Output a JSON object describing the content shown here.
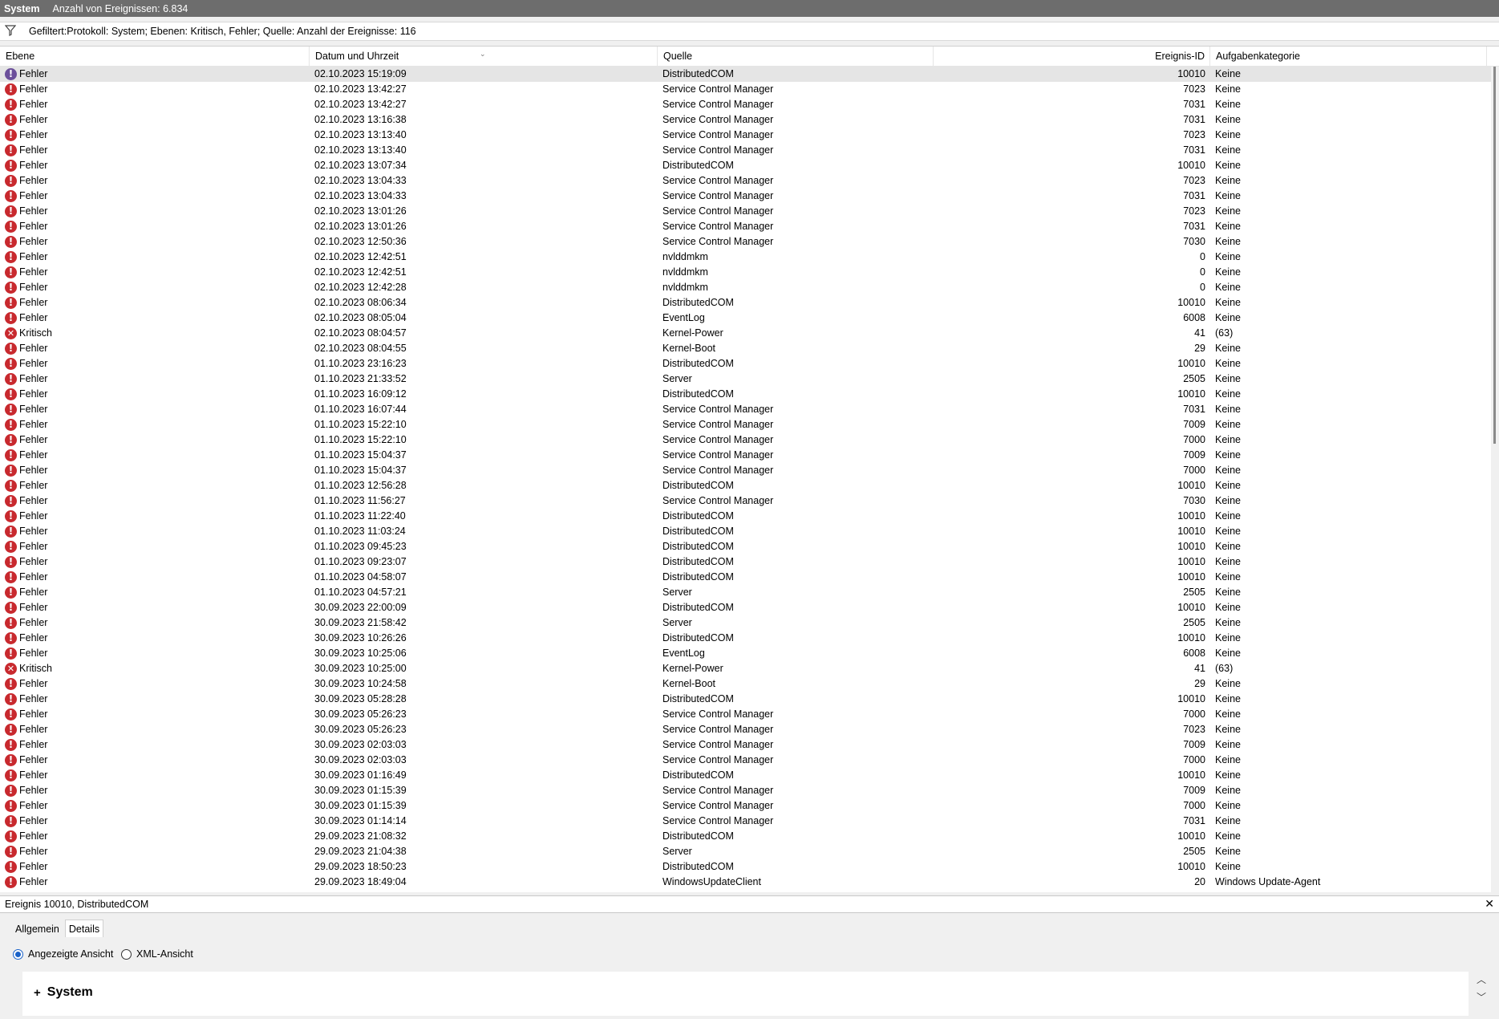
{
  "titlebar": {
    "log_name": "System",
    "count_text": "Anzahl von Ereignissen: 6.834"
  },
  "filter": {
    "text": "Gefiltert:Protokoll: System; Ebenen: Kritisch, Fehler; Quelle:  Anzahl der Ereignisse: 116"
  },
  "columns": {
    "level": "Ebene",
    "date": "Datum und Uhrzeit",
    "source": "Quelle",
    "id": "Ereignis-ID",
    "category": "Aufgabenkategorie"
  },
  "rows": [
    {
      "level": "Fehler",
      "date": "02.10.2023 15:19:09",
      "source": "DistributedCOM",
      "id": "10010",
      "category": "Keine"
    },
    {
      "level": "Fehler",
      "date": "02.10.2023 13:42:27",
      "source": "Service Control Manager",
      "id": "7023",
      "category": "Keine"
    },
    {
      "level": "Fehler",
      "date": "02.10.2023 13:42:27",
      "source": "Service Control Manager",
      "id": "7031",
      "category": "Keine"
    },
    {
      "level": "Fehler",
      "date": "02.10.2023 13:16:38",
      "source": "Service Control Manager",
      "id": "7031",
      "category": "Keine"
    },
    {
      "level": "Fehler",
      "date": "02.10.2023 13:13:40",
      "source": "Service Control Manager",
      "id": "7023",
      "category": "Keine"
    },
    {
      "level": "Fehler",
      "date": "02.10.2023 13:13:40",
      "source": "Service Control Manager",
      "id": "7031",
      "category": "Keine"
    },
    {
      "level": "Fehler",
      "date": "02.10.2023 13:07:34",
      "source": "DistributedCOM",
      "id": "10010",
      "category": "Keine"
    },
    {
      "level": "Fehler",
      "date": "02.10.2023 13:04:33",
      "source": "Service Control Manager",
      "id": "7023",
      "category": "Keine"
    },
    {
      "level": "Fehler",
      "date": "02.10.2023 13:04:33",
      "source": "Service Control Manager",
      "id": "7031",
      "category": "Keine"
    },
    {
      "level": "Fehler",
      "date": "02.10.2023 13:01:26",
      "source": "Service Control Manager",
      "id": "7023",
      "category": "Keine"
    },
    {
      "level": "Fehler",
      "date": "02.10.2023 13:01:26",
      "source": "Service Control Manager",
      "id": "7031",
      "category": "Keine"
    },
    {
      "level": "Fehler",
      "date": "02.10.2023 12:50:36",
      "source": "Service Control Manager",
      "id": "7030",
      "category": "Keine"
    },
    {
      "level": "Fehler",
      "date": "02.10.2023 12:42:51",
      "source": "nvlddmkm",
      "id": "0",
      "category": "Keine"
    },
    {
      "level": "Fehler",
      "date": "02.10.2023 12:42:51",
      "source": "nvlddmkm",
      "id": "0",
      "category": "Keine"
    },
    {
      "level": "Fehler",
      "date": "02.10.2023 12:42:28",
      "source": "nvlddmkm",
      "id": "0",
      "category": "Keine"
    },
    {
      "level": "Fehler",
      "date": "02.10.2023 08:06:34",
      "source": "DistributedCOM",
      "id": "10010",
      "category": "Keine"
    },
    {
      "level": "Fehler",
      "date": "02.10.2023 08:05:04",
      "source": "EventLog",
      "id": "6008",
      "category": "Keine"
    },
    {
      "level": "Kritisch",
      "date": "02.10.2023 08:04:57",
      "source": "Kernel-Power",
      "id": "41",
      "category": "(63)"
    },
    {
      "level": "Fehler",
      "date": "02.10.2023 08:04:55",
      "source": "Kernel-Boot",
      "id": "29",
      "category": "Keine"
    },
    {
      "level": "Fehler",
      "date": "01.10.2023 23:16:23",
      "source": "DistributedCOM",
      "id": "10010",
      "category": "Keine"
    },
    {
      "level": "Fehler",
      "date": "01.10.2023 21:33:52",
      "source": "Server",
      "id": "2505",
      "category": "Keine"
    },
    {
      "level": "Fehler",
      "date": "01.10.2023 16:09:12",
      "source": "DistributedCOM",
      "id": "10010",
      "category": "Keine"
    },
    {
      "level": "Fehler",
      "date": "01.10.2023 16:07:44",
      "source": "Service Control Manager",
      "id": "7031",
      "category": "Keine"
    },
    {
      "level": "Fehler",
      "date": "01.10.2023 15:22:10",
      "source": "Service Control Manager",
      "id": "7009",
      "category": "Keine"
    },
    {
      "level": "Fehler",
      "date": "01.10.2023 15:22:10",
      "source": "Service Control Manager",
      "id": "7000",
      "category": "Keine"
    },
    {
      "level": "Fehler",
      "date": "01.10.2023 15:04:37",
      "source": "Service Control Manager",
      "id": "7009",
      "category": "Keine"
    },
    {
      "level": "Fehler",
      "date": "01.10.2023 15:04:37",
      "source": "Service Control Manager",
      "id": "7000",
      "category": "Keine"
    },
    {
      "level": "Fehler",
      "date": "01.10.2023 12:56:28",
      "source": "DistributedCOM",
      "id": "10010",
      "category": "Keine"
    },
    {
      "level": "Fehler",
      "date": "01.10.2023 11:56:27",
      "source": "Service Control Manager",
      "id": "7030",
      "category": "Keine"
    },
    {
      "level": "Fehler",
      "date": "01.10.2023 11:22:40",
      "source": "DistributedCOM",
      "id": "10010",
      "category": "Keine"
    },
    {
      "level": "Fehler",
      "date": "01.10.2023 11:03:24",
      "source": "DistributedCOM",
      "id": "10010",
      "category": "Keine"
    },
    {
      "level": "Fehler",
      "date": "01.10.2023 09:45:23",
      "source": "DistributedCOM",
      "id": "10010",
      "category": "Keine"
    },
    {
      "level": "Fehler",
      "date": "01.10.2023 09:23:07",
      "source": "DistributedCOM",
      "id": "10010",
      "category": "Keine"
    },
    {
      "level": "Fehler",
      "date": "01.10.2023 04:58:07",
      "source": "DistributedCOM",
      "id": "10010",
      "category": "Keine"
    },
    {
      "level": "Fehler",
      "date": "01.10.2023 04:57:21",
      "source": "Server",
      "id": "2505",
      "category": "Keine"
    },
    {
      "level": "Fehler",
      "date": "30.09.2023 22:00:09",
      "source": "DistributedCOM",
      "id": "10010",
      "category": "Keine"
    },
    {
      "level": "Fehler",
      "date": "30.09.2023 21:58:42",
      "source": "Server",
      "id": "2505",
      "category": "Keine"
    },
    {
      "level": "Fehler",
      "date": "30.09.2023 10:26:26",
      "source": "DistributedCOM",
      "id": "10010",
      "category": "Keine"
    },
    {
      "level": "Fehler",
      "date": "30.09.2023 10:25:06",
      "source": "EventLog",
      "id": "6008",
      "category": "Keine"
    },
    {
      "level": "Kritisch",
      "date": "30.09.2023 10:25:00",
      "source": "Kernel-Power",
      "id": "41",
      "category": "(63)"
    },
    {
      "level": "Fehler",
      "date": "30.09.2023 10:24:58",
      "source": "Kernel-Boot",
      "id": "29",
      "category": "Keine"
    },
    {
      "level": "Fehler",
      "date": "30.09.2023 05:28:28",
      "source": "DistributedCOM",
      "id": "10010",
      "category": "Keine"
    },
    {
      "level": "Fehler",
      "date": "30.09.2023 05:26:23",
      "source": "Service Control Manager",
      "id": "7000",
      "category": "Keine"
    },
    {
      "level": "Fehler",
      "date": "30.09.2023 05:26:23",
      "source": "Service Control Manager",
      "id": "7023",
      "category": "Keine"
    },
    {
      "level": "Fehler",
      "date": "30.09.2023 02:03:03",
      "source": "Service Control Manager",
      "id": "7009",
      "category": "Keine"
    },
    {
      "level": "Fehler",
      "date": "30.09.2023 02:03:03",
      "source": "Service Control Manager",
      "id": "7000",
      "category": "Keine"
    },
    {
      "level": "Fehler",
      "date": "30.09.2023 01:16:49",
      "source": "DistributedCOM",
      "id": "10010",
      "category": "Keine"
    },
    {
      "level": "Fehler",
      "date": "30.09.2023 01:15:39",
      "source": "Service Control Manager",
      "id": "7009",
      "category": "Keine"
    },
    {
      "level": "Fehler",
      "date": "30.09.2023 01:15:39",
      "source": "Service Control Manager",
      "id": "7000",
      "category": "Keine"
    },
    {
      "level": "Fehler",
      "date": "30.09.2023 01:14:14",
      "source": "Service Control Manager",
      "id": "7031",
      "category": "Keine"
    },
    {
      "level": "Fehler",
      "date": "29.09.2023 21:08:32",
      "source": "DistributedCOM",
      "id": "10010",
      "category": "Keine"
    },
    {
      "level": "Fehler",
      "date": "29.09.2023 21:04:38",
      "source": "Server",
      "id": "2505",
      "category": "Keine"
    },
    {
      "level": "Fehler",
      "date": "29.09.2023 18:50:23",
      "source": "DistributedCOM",
      "id": "10010",
      "category": "Keine"
    },
    {
      "level": "Fehler",
      "date": "29.09.2023 18:49:04",
      "source": "WindowsUpdateClient",
      "id": "20",
      "category": "Windows Update-Agent"
    }
  ],
  "selected_row": 0,
  "detail": {
    "title": "Ereignis 10010, DistributedCOM",
    "close_icon": "close-icon",
    "tabs": [
      "Allgemein",
      "Details"
    ],
    "active_tab": "Details",
    "radio_displayed": "Angezeigte Ansicht",
    "radio_xml": "XML-Ansicht",
    "radio_selected": "Angezeigte Ansicht",
    "section_toggle": "+",
    "section": "System"
  },
  "colors": {
    "error": "#c8292e",
    "titlebar": "#6d6d6d",
    "radio_accent": "#1a62c8",
    "selected_row": "#e5e5e5"
  }
}
